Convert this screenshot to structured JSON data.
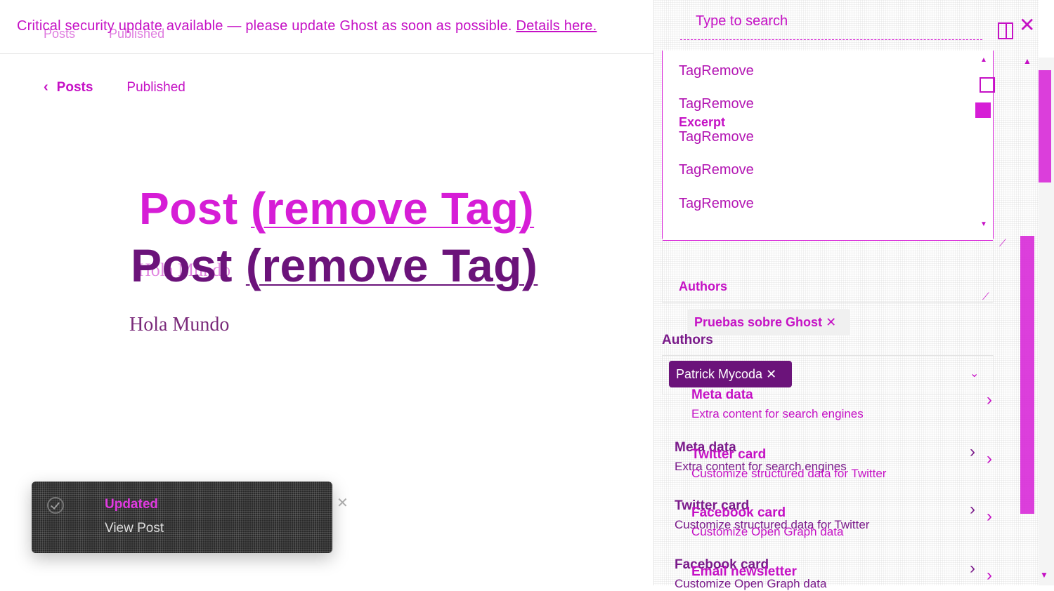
{
  "banner": {
    "message": "Critical security update available — please update Ghost as soon as possible.",
    "link": "Details here."
  },
  "breadcrumb": {
    "back_label": "Posts",
    "status": "Published"
  },
  "editor": {
    "title_part1": "Post ",
    "title_part2": "(remove Tag)",
    "body": "Hola Mundo"
  },
  "toast": {
    "status": "Updated",
    "action": "View Post"
  },
  "settings": {
    "search_placeholder": "Type to search",
    "dropdown_items": [
      "TagRemove",
      "TagRemove",
      "TagRemove",
      "TagRemove",
      "TagRemove"
    ],
    "excerpt_label": "Excerpt",
    "authors_label": "Authors",
    "tag_chip": "Pruebas sobre Ghost",
    "author_chip": "Patrick Mycoda",
    "menu": [
      {
        "title": "Meta data",
        "subtitle": "Extra content for search engines"
      },
      {
        "title": "Twitter card",
        "subtitle": "Customize structured data for Twitter"
      },
      {
        "title": "Facebook card",
        "subtitle": "Customize Open Graph data"
      },
      {
        "title": "Email newsletter",
        "subtitle": ""
      }
    ]
  },
  "colors": {
    "accent": "#d61dd6",
    "dark": "#6b137a"
  }
}
